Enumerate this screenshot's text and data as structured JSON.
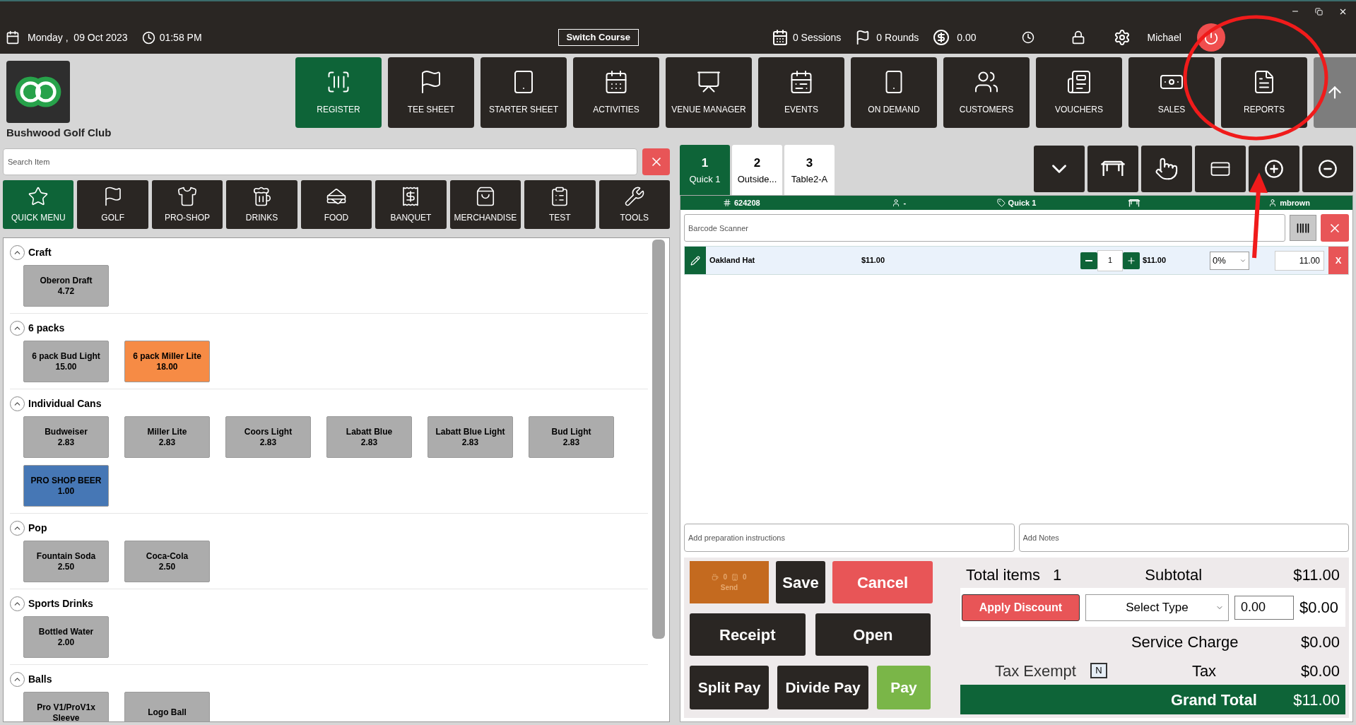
{
  "header": {
    "date": "Monday ,  09 Oct 2023",
    "time": "01:58 PM",
    "switch_course": "Switch Course",
    "sessions": "0 Sessions",
    "rounds": "0 Rounds",
    "balance": "0.00",
    "user": "Michael"
  },
  "club_name": "Bushwood Golf Club",
  "nav": [
    {
      "label": "REGISTER",
      "kind": "scanner",
      "selected": true
    },
    {
      "label": "TEE SHEET",
      "kind": "flagsheet",
      "selected": false
    },
    {
      "label": "STARTER SHEET",
      "kind": "tablet",
      "selected": false
    },
    {
      "label": "ACTIVITIES",
      "kind": "calendar",
      "selected": false
    },
    {
      "label": "VENUE MANAGER",
      "kind": "meeting",
      "selected": false
    },
    {
      "label": "EVENTS",
      "kind": "events",
      "selected": false
    },
    {
      "label": "ON DEMAND",
      "kind": "phone",
      "selected": false
    },
    {
      "label": "CUSTOMERS",
      "kind": "people",
      "selected": false
    },
    {
      "label": "VOUCHERS",
      "kind": "news",
      "selected": false
    },
    {
      "label": "SALES",
      "kind": "money",
      "selected": false
    },
    {
      "label": "REPORTS",
      "kind": "report",
      "selected": false
    }
  ],
  "search": {
    "placeholder": "Search Item"
  },
  "categories": [
    {
      "label": "QUICK MENU",
      "kind": "star",
      "selected": true
    },
    {
      "label": "GOLF",
      "kind": "golf",
      "selected": false
    },
    {
      "label": "PRO-SHOP",
      "kind": "shirt",
      "selected": false
    },
    {
      "label": "DRINKS",
      "kind": "beer",
      "selected": false
    },
    {
      "label": "FOOD",
      "kind": "food",
      "selected": false
    },
    {
      "label": "BANQUET",
      "kind": "receipt",
      "selected": false
    },
    {
      "label": "MERCHANDISE",
      "kind": "bag",
      "selected": false
    },
    {
      "label": "TEST",
      "kind": "clipboard",
      "selected": false
    },
    {
      "label": "TOOLS",
      "kind": "tools",
      "selected": false
    }
  ],
  "sections": [
    {
      "title": "Craft",
      "expanded": true,
      "items": [
        {
          "name": "Oberon Draft",
          "price": "4.72",
          "color": "#acacac"
        }
      ]
    },
    {
      "title": "6 packs",
      "expanded": true,
      "items": [
        {
          "name": "6 pack Bud Light",
          "price": "15.00",
          "color": "#acacac"
        },
        {
          "name": "6 pack Miller Lite",
          "price": "18.00",
          "color": "#f68b45"
        }
      ]
    },
    {
      "title": "Individual Cans",
      "expanded": true,
      "items": [
        {
          "name": "Budweiser",
          "price": "2.83",
          "color": "#acacac"
        },
        {
          "name": "Miller Lite",
          "price": "2.83",
          "color": "#acacac"
        },
        {
          "name": "Coors Light",
          "price": "2.83",
          "color": "#acacac"
        },
        {
          "name": "Labatt Blue",
          "price": "2.83",
          "color": "#acacac"
        },
        {
          "name": "Labatt Blue Light",
          "price": "2.83",
          "color": "#acacac"
        },
        {
          "name": "Bud Light",
          "price": "2.83",
          "color": "#acacac"
        },
        {
          "name": "PRO SHOP BEER",
          "price": "1.00",
          "color": "#4677b5"
        }
      ]
    },
    {
      "title": "Pop",
      "expanded": true,
      "items": [
        {
          "name": "Fountain Soda",
          "price": "2.50",
          "color": "#acacac"
        },
        {
          "name": "Coca-Cola",
          "price": "2.50",
          "color": "#acacac"
        }
      ]
    },
    {
      "title": "Sports Drinks",
      "expanded": true,
      "items": [
        {
          "name": "Bottled Water",
          "price": "2.00",
          "color": "#acacac"
        }
      ]
    },
    {
      "title": "Balls",
      "expanded": true,
      "items": [
        {
          "name": "Pro V1/ProV1x Sleeve",
          "color": "#acacac"
        },
        {
          "name": "Logo Ball",
          "color": "#acacac"
        }
      ]
    }
  ],
  "order_tabs": [
    {
      "number": "1",
      "name": "Quick 1",
      "selected": true
    },
    {
      "number": "2",
      "name": "Outside...",
      "selected": false
    },
    {
      "number": "3",
      "name": "Table2-A",
      "selected": false
    }
  ],
  "order_info": {
    "number": "624208",
    "customer": "-",
    "tab": "Quick 1",
    "server": "mbrown"
  },
  "barcode": {
    "placeholder": "Barcode Scanner"
  },
  "lines": [
    {
      "name": "Oakland Hat",
      "price": "$11.00",
      "qty": "1",
      "total": "$11.00",
      "discount": "0%",
      "amount": "11.00",
      "delete": "X"
    }
  ],
  "notes": {
    "prep_placeholder": "Add preparation instructions",
    "notes_placeholder": "Add Notes"
  },
  "send": {
    "count_a": "0",
    "count_b": "0",
    "label": "Send",
    "disabled": true
  },
  "buttons": [
    {
      "label": "Save",
      "kind": "dark"
    },
    {
      "label": "Cancel",
      "kind": "danger"
    },
    {
      "label": "Receipt",
      "kind": "dark"
    },
    {
      "label": "Open",
      "kind": "dark"
    },
    {
      "label": "Split Pay",
      "kind": "dark"
    },
    {
      "label": "Divide Pay",
      "kind": "dark"
    },
    {
      "label": "Pay",
      "kind": "success"
    }
  ],
  "totals": {
    "items_label": "Total items",
    "items_count": "1",
    "subtotal_label": "Subtotal",
    "subtotal": "$11.00",
    "discount_button": "Apply Discount",
    "discount_type": "Select Type",
    "discount_value": "0.00",
    "discount": "$0.00",
    "service_label": "Service Charge",
    "service": "$0.00",
    "tax_exempt_label": "Tax Exempt",
    "tax_exempt_value": "N",
    "tax_label": "Tax",
    "tax": "$0.00",
    "grand_label": "Grand Total",
    "grand": "$11.00"
  }
}
